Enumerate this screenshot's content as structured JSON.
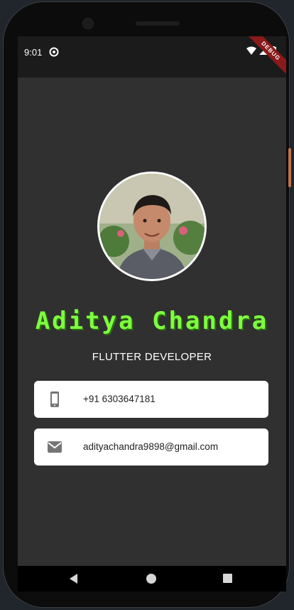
{
  "status_bar": {
    "time": "9:01",
    "debug_banner": "DEBUG"
  },
  "profile": {
    "name": "Aditya Chandra",
    "title": "FLUTTER DEVELOPER",
    "avatar_icon": "avatar-photo"
  },
  "contacts": [
    {
      "icon": "phone-icon",
      "text": "+91 6303647181"
    },
    {
      "icon": "email-icon",
      "text": "adityachandra9898@gmail.com"
    }
  ],
  "colors": {
    "background": "#303030",
    "name_color": "#7dff3f",
    "card_bg": "#ffffff",
    "icon_color": "#757575"
  },
  "nav": {
    "back": "back-icon",
    "home": "home-icon",
    "recent": "recent-apps-icon"
  }
}
